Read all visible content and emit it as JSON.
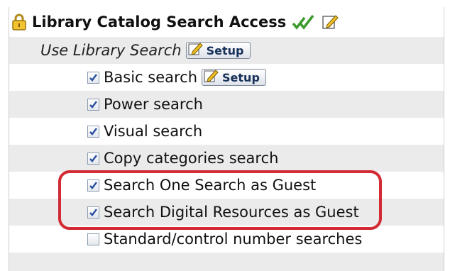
{
  "header": {
    "title": "Library Catalog Search Access",
    "lock_icon": "lock-icon",
    "checkmark_icon": "green-checks-icon",
    "edit_icon": "edit-pencil-icon"
  },
  "section": {
    "label": "Use Library Search",
    "setup_label": "Setup"
  },
  "items": [
    {
      "label": "Basic search",
      "checked": true,
      "setup_label": "Setup"
    },
    {
      "label": "Power search",
      "checked": true
    },
    {
      "label": "Visual search",
      "checked": true
    },
    {
      "label": "Copy categories search",
      "checked": true
    },
    {
      "label": "Search One Search as Guest",
      "checked": true
    },
    {
      "label": "Search Digital Resources as Guest",
      "checked": true
    },
    {
      "label": "Standard/control number searches",
      "checked": false
    }
  ],
  "colors": {
    "highlight": "#d22b35",
    "row_shade": "#ebebeb",
    "check": "#2a4f9e"
  }
}
